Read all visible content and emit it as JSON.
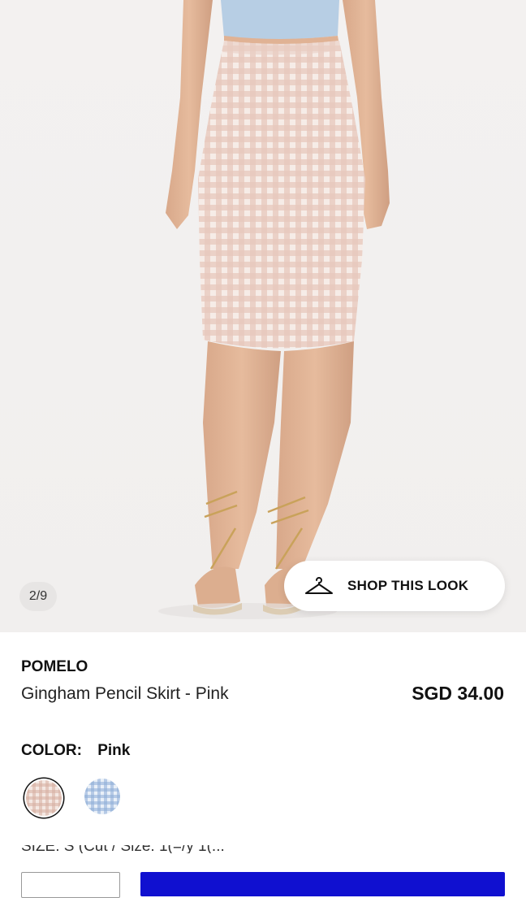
{
  "gallery": {
    "counter": "2/9",
    "shop_look_label": "SHOP THIS LOOK"
  },
  "product": {
    "brand": "POMELO",
    "name": "Gingham Pencil Skirt - Pink",
    "price": "SGD 34.00"
  },
  "color": {
    "label": "COLOR:",
    "selected": "Pink",
    "options": [
      "pink-gingham",
      "blue-gingham"
    ]
  },
  "size": {
    "label_partial": "SIZE:   S   (Cut / Size: 1(=/y 1(..."
  },
  "colors": {
    "accent": "#1010d0",
    "photo_bg": "#f2f0ef"
  }
}
